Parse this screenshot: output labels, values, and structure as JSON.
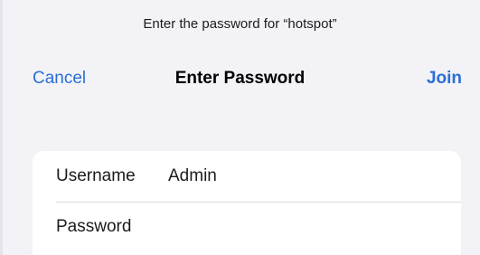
{
  "prompt": "Enter the password for “hotspot”",
  "nav": {
    "cancel_label": "Cancel",
    "title": "Enter Password",
    "join_label": "Join"
  },
  "form": {
    "username_label": "Username",
    "username_value": "Admin",
    "password_label": "Password",
    "password_value": ""
  }
}
